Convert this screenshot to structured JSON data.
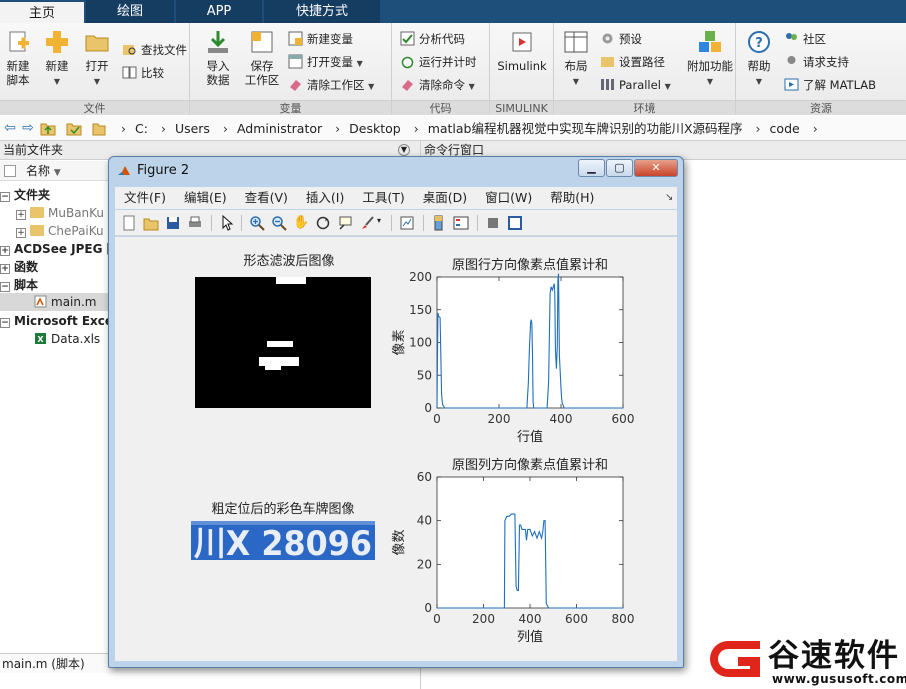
{
  "tabs": [
    "主页",
    "绘图",
    "APP",
    "快捷方式"
  ],
  "ribbon": {
    "file": {
      "new_script": "新建\n脚本",
      "new": "新建",
      "open": "打开",
      "find_files": "查找文件",
      "compare": "比较",
      "label": "文件"
    },
    "variable": {
      "import": "导入\n数据",
      "save_ws": "保存\n工作区",
      "new_var": "新建变量",
      "open_var": "打开变量",
      "clear_ws": "清除工作区",
      "label": "变量"
    },
    "code": {
      "analyze": "分析代码",
      "run_time": "运行并计时",
      "clear_cmd": "清除命令",
      "label": "代码"
    },
    "simulink": {
      "simulink": "Simulink",
      "label": "SIMULINK"
    },
    "env": {
      "layout": "布局",
      "prefs": "预设",
      "set_path": "设置路径",
      "parallel": "Parallel",
      "addons": "附加功能",
      "label": "环境"
    },
    "resources": {
      "help": "帮助",
      "community": "社区",
      "support": "请求支持",
      "learn": "了解 MATLAB",
      "label": "资源"
    }
  },
  "address": {
    "crumbs": [
      "C:",
      "Users",
      "Administrator",
      "Desktop",
      "matlab编程机器视觉中实现车牌识别的功能川X源码程序",
      "code"
    ]
  },
  "left_panel": {
    "title": "当前文件夹",
    "name_col": "名称",
    "tree": {
      "folders_group": "文件夹",
      "folder1": "MuBanKu",
      "folder2": "ChePaiKu",
      "acdsee": "ACDSee JPEG 图",
      "functions": "函数",
      "scripts": "脚本",
      "main_m": "main.m",
      "excel_group": "Microsoft Excel",
      "data_xls": "Data.xls"
    },
    "status": "main.m  (脚本)"
  },
  "right_panel": {
    "title": "命令行窗口"
  },
  "figure": {
    "title": "Figure 2",
    "menus": [
      "文件(F)",
      "编辑(E)",
      "查看(V)",
      "插入(I)",
      "工具(T)",
      "桌面(D)",
      "窗口(W)",
      "帮助(H)"
    ],
    "morph_title": "形态滤波后图像",
    "plate_title": "粗定位后的彩色车牌图像",
    "plate_text": "川X 28096"
  },
  "chart_data": [
    {
      "type": "line",
      "title": "原图行方向像素点值累计和",
      "xlabel": "行值",
      "ylabel": "像素",
      "xlim": [
        0,
        600
      ],
      "ylim": [
        0,
        200
      ],
      "xticks": [
        0,
        200,
        400,
        600
      ],
      "yticks": [
        0,
        50,
        100,
        150,
        200
      ],
      "color": "#1f6fbf",
      "x": [
        0,
        3,
        5,
        10,
        15,
        18,
        25,
        30,
        290,
        295,
        298,
        302,
        304,
        306,
        308,
        310,
        312,
        330,
        335,
        340,
        350,
        355,
        360,
        365,
        368,
        372,
        375,
        378,
        380,
        382,
        385,
        388,
        390,
        392,
        395,
        400,
        402,
        404,
        406,
        410,
        600
      ],
      "y": [
        0,
        145,
        140,
        138,
        20,
        5,
        0,
        0,
        0,
        40,
        90,
        130,
        135,
        128,
        80,
        10,
        0,
        0,
        0,
        0,
        0,
        0,
        40,
        175,
        185,
        180,
        185,
        190,
        175,
        90,
        60,
        95,
        195,
        205,
        80,
        30,
        15,
        8,
        5,
        0,
        0
      ]
    },
    {
      "type": "line",
      "title": "原图列方向像素点值累计和",
      "xlabel": "列值",
      "ylabel": "像数",
      "xlim": [
        0,
        800
      ],
      "ylim": [
        0,
        60
      ],
      "xticks": [
        0,
        200,
        400,
        600,
        800
      ],
      "yticks": [
        0,
        20,
        40,
        60
      ],
      "color": "#1f6fbf",
      "x": [
        0,
        290,
        292,
        300,
        310,
        320,
        335,
        340,
        345,
        350,
        355,
        360,
        365,
        370,
        380,
        385,
        390,
        400,
        410,
        420,
        430,
        440,
        450,
        455,
        460,
        465,
        470,
        480,
        800
      ],
      "y": [
        0,
        0,
        40,
        42,
        42,
        43,
        43,
        10,
        8,
        8,
        38,
        38,
        36,
        36,
        36,
        31,
        36,
        36,
        33,
        35,
        32,
        35,
        32,
        35,
        40,
        40,
        2,
        0,
        0
      ]
    }
  ],
  "watermark": {
    "brand": "谷速软件",
    "url": "www.gususoft.com"
  },
  "colors": {
    "tab_bar": "#1e4f7b",
    "plot_line": "#1f6fbf",
    "plate_bg": "#2b67c4",
    "brand_red": "#e0251b"
  }
}
